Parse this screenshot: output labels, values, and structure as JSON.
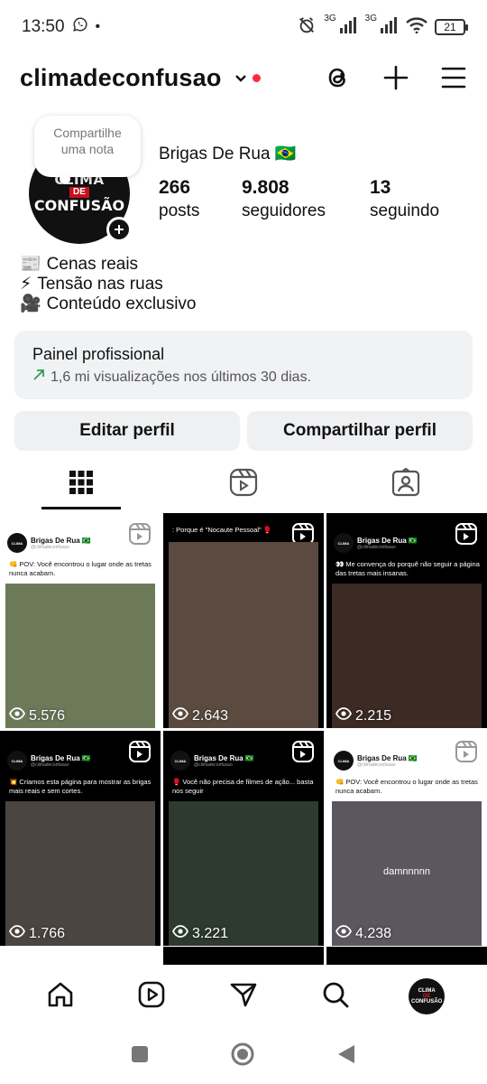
{
  "status_bar": {
    "time": "13:50",
    "battery": "21",
    "net1": "3G",
    "net2": "3G"
  },
  "header": {
    "username": "climadeconfusao"
  },
  "profile": {
    "note_text": "Compartilhe uma nota",
    "avatar_line1": "CLIMA",
    "avatar_line2": "DE",
    "avatar_line3": "CONFUSÃO",
    "display_name": "Brigas De Rua 🇧🇷",
    "stats": [
      {
        "value": "266",
        "label": "posts"
      },
      {
        "value": "9.808",
        "label": "seguidores"
      },
      {
        "value": "13",
        "label": "seguindo"
      }
    ],
    "bio": [
      {
        "emoji": "📰",
        "text": "Cenas reais"
      },
      {
        "emoji": "⚡",
        "text": "Tensão nas ruas"
      },
      {
        "emoji": "🎥",
        "text": "Conteúdo exclusivo"
      }
    ]
  },
  "pro_panel": {
    "title": "Painel profissional",
    "subtitle": "1,6 mi visualizações nos últimos 30 dias."
  },
  "buttons": {
    "edit": "Editar perfil",
    "share": "Compartilhar perfil"
  },
  "grid": [
    {
      "theme": "light",
      "account": "Brigas De Rua 🇧🇷",
      "handle": "@climadeconfusao",
      "caption": "👊 POV: Você encontrou o lugar onde as tretas nunca acabam.",
      "views": "5.576",
      "media_color": "#6d7a5a",
      "media_overlay": ""
    },
    {
      "theme": "dark",
      "account": "",
      "handle": "",
      "caption": ": Porque é \"Nocaute Pessoal\" 🥊",
      "views": "2.643",
      "media_color": "#5a4a3f",
      "media_overlay": ""
    },
    {
      "theme": "dark",
      "account": "Brigas De Rua 🇧🇷",
      "handle": "@climadeconfusao",
      "caption": "👀 Me convença do porquê não seguir a página das tretas mais insanas.",
      "views": "2.215",
      "media_color": "#3c2a25",
      "media_overlay": ""
    },
    {
      "theme": "dark",
      "account": "Brigas De Rua 🇧🇷",
      "handle": "@climadeconfusao",
      "caption": "💥 Criamos esta página para mostrar as brigas mais reais e sem cortes.",
      "views": "1.766",
      "media_color": "#4a4540",
      "media_overlay": ""
    },
    {
      "theme": "dark",
      "account": "Brigas De Rua 🇧🇷",
      "handle": "@climadeconfusao",
      "caption": "🥊 Você não precisa de filmes de ação... basta nos seguir",
      "views": "3.221",
      "media_color": "#2e3a2e",
      "media_overlay": ""
    },
    {
      "theme": "light",
      "account": "Brigas De Rua 🇧🇷",
      "handle": "@climadeconfusao",
      "caption": "👊 POV: Você encontrou o lugar onde as tretas nunca acabam.",
      "views": "4.238",
      "media_color": "#5b5660",
      "media_overlay": "damnnnnn"
    }
  ]
}
